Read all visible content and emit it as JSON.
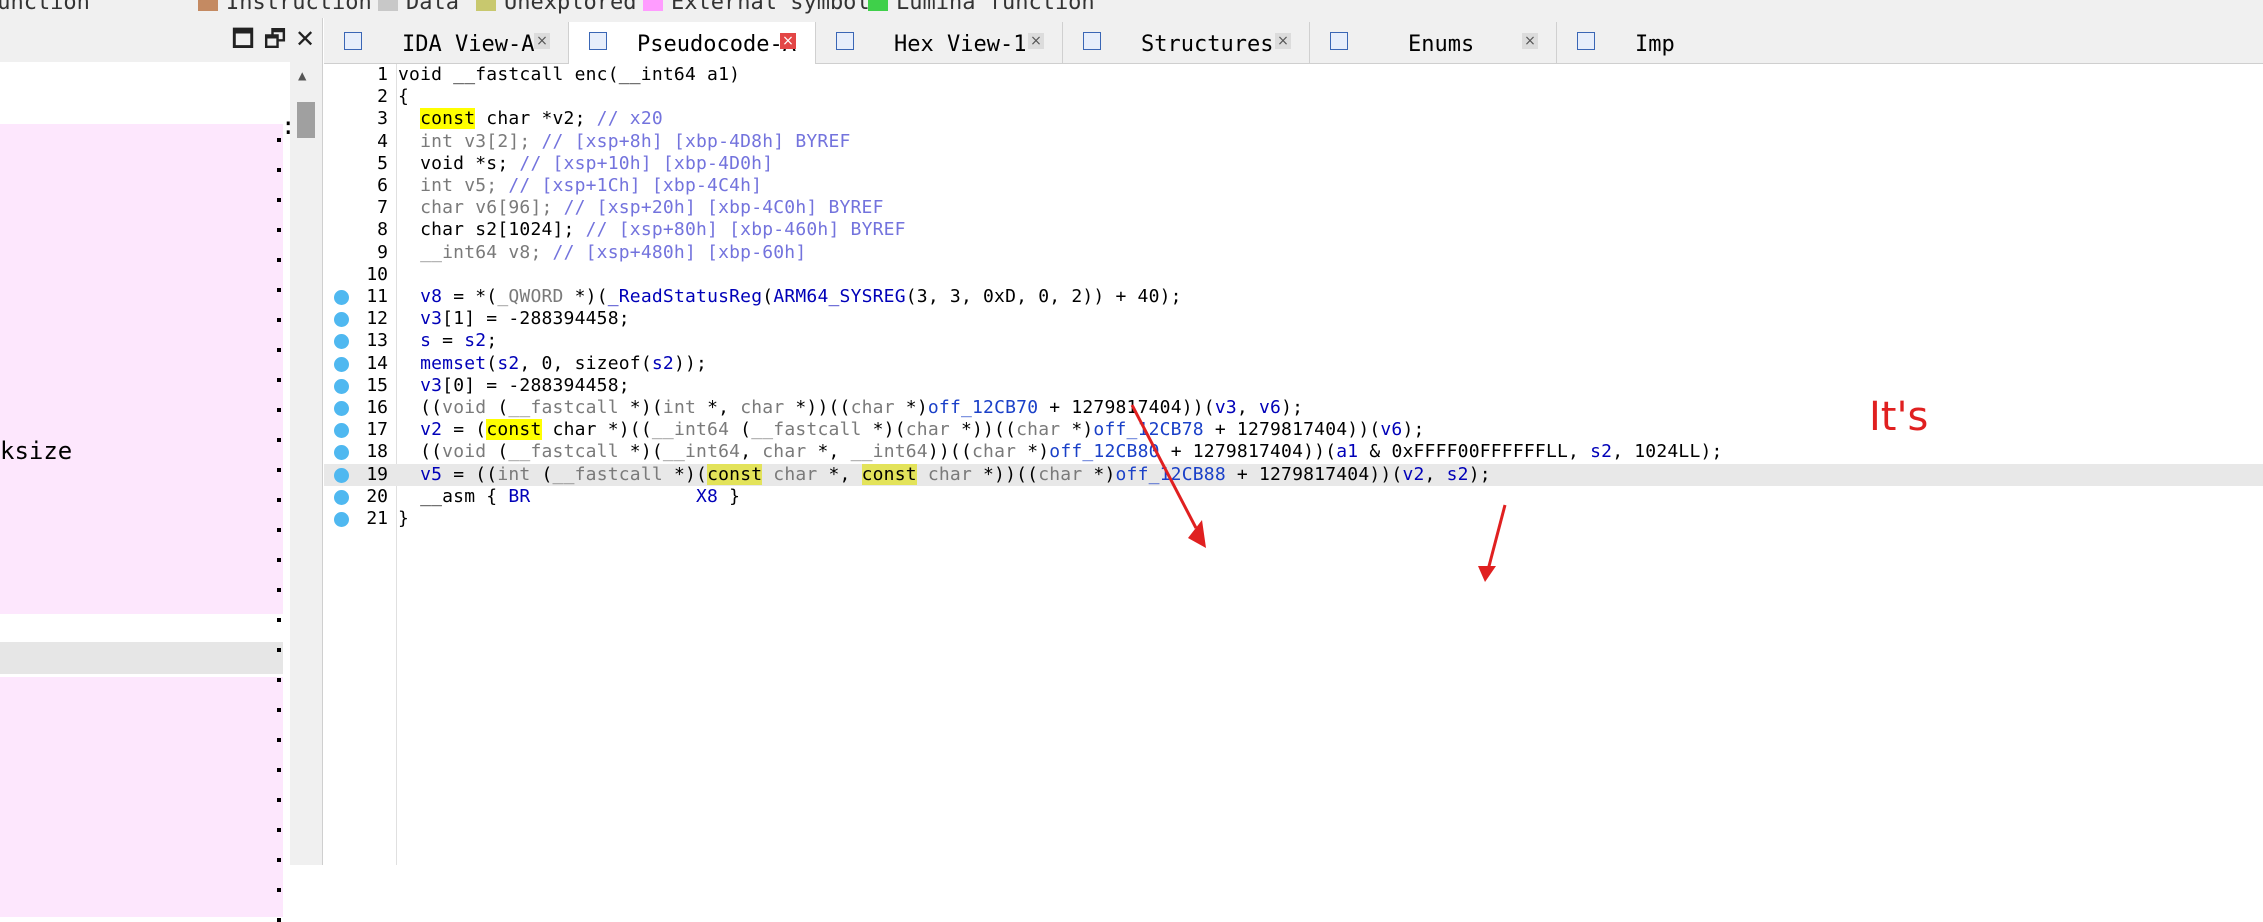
{
  "legend": [
    {
      "label": "Regular function",
      "color": "#9ad7ff"
    },
    {
      "label": "Instruction",
      "color": "#c48a62"
    },
    {
      "label": "Data",
      "color": "#c8c8c8"
    },
    {
      "label": "Unexplored",
      "color": "#c8c86e"
    },
    {
      "label": "External symbol",
      "color": "#ff9cff"
    },
    {
      "label": "Lumina function",
      "color": "#3fd04a"
    }
  ],
  "left_panel": {
    "visible_text": "ksize",
    "colon": ":",
    "buttons": {
      "maximize": "🗖",
      "restore": "🗗",
      "close": "✕"
    },
    "scroll_arrow": "▲"
  },
  "tabs": [
    {
      "label": "IDA View-A",
      "close": "×",
      "active": false
    },
    {
      "label": "Pseudocode-A",
      "close": "×",
      "active": true
    },
    {
      "label": "Hex View-1",
      "close": "×",
      "active": false
    },
    {
      "label": "Structures",
      "close": "×",
      "active": false
    },
    {
      "label": "Enums",
      "close": "×",
      "active": false
    },
    {
      "label": "Imp",
      "close": "",
      "active": false
    }
  ],
  "code": {
    "highlight_line": 19,
    "lines": [
      {
        "n": "1",
        "bp": false,
        "segs": [
          [
            "",
            "void __fastcall enc(__int64 a1)"
          ]
        ]
      },
      {
        "n": "2",
        "bp": false,
        "segs": [
          [
            "",
            "{"
          ]
        ]
      },
      {
        "n": "3",
        "bp": false,
        "segs": [
          [
            "",
            "  "
          ],
          [
            "kw",
            "const"
          ],
          [
            "",
            " char *v2; "
          ],
          [
            "cm",
            "// x20"
          ]
        ]
      },
      {
        "n": "4",
        "bp": false,
        "segs": [
          [
            "gr",
            "  int v3[2]; "
          ],
          [
            "cm",
            "// [xsp+8h] [xbp-4D8h] BYREF"
          ]
        ]
      },
      {
        "n": "5",
        "bp": false,
        "segs": [
          [
            "",
            "  void *s; "
          ],
          [
            "cm",
            "// [xsp+10h] [xbp-4D0h]"
          ]
        ]
      },
      {
        "n": "6",
        "bp": false,
        "segs": [
          [
            "gr",
            "  int v5; "
          ],
          [
            "cm",
            "// [xsp+1Ch] [xbp-4C4h]"
          ]
        ]
      },
      {
        "n": "7",
        "bp": false,
        "segs": [
          [
            "gr",
            "  char v6[96]; "
          ],
          [
            "cm",
            "// [xsp+20h] [xbp-4C0h] BYREF"
          ]
        ]
      },
      {
        "n": "8",
        "bp": false,
        "segs": [
          [
            "",
            "  char s2[1024]; "
          ],
          [
            "cm",
            "// [xsp+80h] [xbp-460h] BYREF"
          ]
        ]
      },
      {
        "n": "9",
        "bp": false,
        "segs": [
          [
            "gr",
            "  __int64 v8; "
          ],
          [
            "cm",
            "// [xsp+480h] [xbp-60h]"
          ]
        ]
      },
      {
        "n": "10",
        "bp": false,
        "segs": [
          [
            "",
            ""
          ]
        ]
      },
      {
        "n": "11",
        "bp": true,
        "segs": [
          [
            "fn",
            "  v8"
          ],
          [
            "",
            " = *("
          ],
          [
            "gr",
            "_QWORD"
          ],
          [
            "",
            " *)("
          ],
          [
            "fn",
            "_ReadStatusReg"
          ],
          [
            "",
            "("
          ],
          [
            "fn",
            "ARM64_SYSREG"
          ],
          [
            "",
            "(3, 3, 0xD, 0, 2)) + 40);"
          ]
        ]
      },
      {
        "n": "12",
        "bp": true,
        "segs": [
          [
            "fn",
            "  v3"
          ],
          [
            "",
            "[1] = -288394458;"
          ]
        ]
      },
      {
        "n": "13",
        "bp": true,
        "segs": [
          [
            "fn",
            "  s"
          ],
          [
            "",
            " = "
          ],
          [
            "fn",
            "s2"
          ],
          [
            "",
            ";"
          ]
        ]
      },
      {
        "n": "14",
        "bp": true,
        "segs": [
          [
            "fn",
            "  memset"
          ],
          [
            "",
            "("
          ],
          [
            "fn",
            "s2"
          ],
          [
            "",
            ", 0, sizeof("
          ],
          [
            "fn",
            "s2"
          ],
          [
            "",
            "));"
          ]
        ]
      },
      {
        "n": "15",
        "bp": true,
        "segs": [
          [
            "fn",
            "  v3"
          ],
          [
            "",
            "[0] = -288394458;"
          ]
        ]
      },
      {
        "n": "16",
        "bp": true,
        "segs": [
          [
            "",
            "  (("
          ],
          [
            "gr",
            "void"
          ],
          [
            "",
            " ("
          ],
          [
            "gr",
            "__fastcall"
          ],
          [
            "",
            " *)("
          ],
          [
            "gr",
            "int"
          ],
          [
            "",
            " *, "
          ],
          [
            "gr",
            "char"
          ],
          [
            "",
            " *))(("
          ],
          [
            "gr",
            "char"
          ],
          [
            "",
            " *)"
          ],
          [
            "gv",
            "off_12CB70"
          ],
          [
            "",
            " + 1279817404))("
          ],
          [
            "fn",
            "v3"
          ],
          [
            "",
            ", "
          ],
          [
            "fn",
            "v6"
          ],
          [
            "",
            ");"
          ]
        ]
      },
      {
        "n": "17",
        "bp": true,
        "segs": [
          [
            "fn",
            "  v2"
          ],
          [
            "",
            " = ("
          ],
          [
            "kw",
            "const"
          ],
          [
            "",
            " char *)(("
          ],
          [
            "gr",
            "__int64"
          ],
          [
            "",
            " ("
          ],
          [
            "gr",
            "__fastcall"
          ],
          [
            "",
            " *)("
          ],
          [
            "gr",
            "char"
          ],
          [
            "",
            " *))(("
          ],
          [
            "gr",
            "char"
          ],
          [
            "",
            " *)"
          ],
          [
            "gv",
            "off_12CB78"
          ],
          [
            "",
            " + 1279817404))("
          ],
          [
            "fn",
            "v6"
          ],
          [
            "",
            ");"
          ]
        ]
      },
      {
        "n": "18",
        "bp": true,
        "segs": [
          [
            "",
            "  (("
          ],
          [
            "gr",
            "void"
          ],
          [
            "",
            " ("
          ],
          [
            "gr",
            "__fastcall"
          ],
          [
            "",
            " *)("
          ],
          [
            "gr",
            "__int64"
          ],
          [
            "",
            ", "
          ],
          [
            "gr",
            "char"
          ],
          [
            "",
            " *, "
          ],
          [
            "gr",
            "__int64"
          ],
          [
            "",
            "))(("
          ],
          [
            "gr",
            "char"
          ],
          [
            "",
            " *)"
          ],
          [
            "gv",
            "off_12CB80"
          ],
          [
            "",
            " + 1279817404))("
          ],
          [
            "fn",
            "a1"
          ],
          [
            "",
            " & 0xFFFF00FFFFFFLL, "
          ],
          [
            "fn",
            "s2"
          ],
          [
            "",
            ", 1024LL);"
          ]
        ]
      },
      {
        "n": "19",
        "bp": true,
        "segs": [
          [
            "fn",
            "  v5"
          ],
          [
            "",
            " = (("
          ],
          [
            "gr",
            "int"
          ],
          [
            "",
            " ("
          ],
          [
            "gr",
            "__fastcall"
          ],
          [
            "",
            " *)("
          ],
          [
            "kw2",
            "const"
          ],
          [
            "gr",
            " char"
          ],
          [
            "",
            " *, "
          ],
          [
            "kw2",
            "const"
          ],
          [
            "gr",
            " char"
          ],
          [
            "",
            " *))(("
          ],
          [
            "gr",
            "char"
          ],
          [
            "",
            " *)"
          ],
          [
            "gv",
            "off_12CB88"
          ],
          [
            "",
            " + 1279817404))("
          ],
          [
            "fn",
            "v2"
          ],
          [
            "",
            ", "
          ],
          [
            "fn",
            "s2"
          ],
          [
            "",
            ");"
          ]
        ]
      },
      {
        "n": "20",
        "bp": true,
        "segs": [
          [
            "",
            "  __asm { "
          ],
          [
            "fn",
            "BR"
          ],
          [
            "",
            "               "
          ],
          [
            "fn",
            "X8"
          ],
          [
            "",
            " }"
          ]
        ]
      },
      {
        "n": "21",
        "bp": true,
        "segs": [
          [
            "",
            "}"
          ]
        ]
      }
    ]
  },
  "side_text": "It's",
  "colors": {
    "breakpoint": "#4fb8f0",
    "keyword_highlight": "#ffff00",
    "comment": "#7373dd",
    "arrow": "#e02020"
  }
}
